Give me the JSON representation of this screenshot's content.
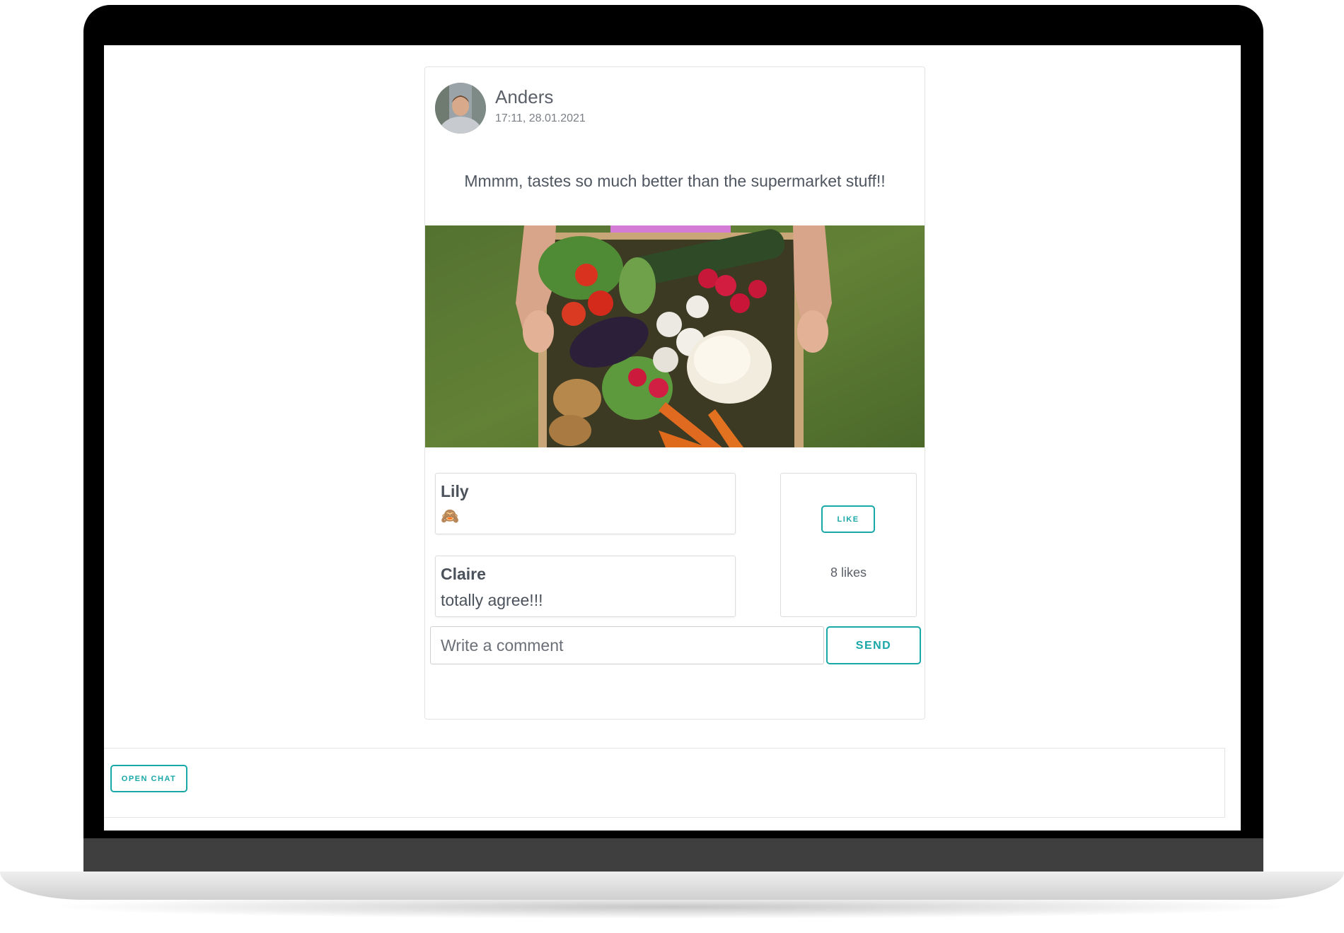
{
  "post": {
    "author": "Anders",
    "timestamp": "17:11, 28.01.2021",
    "text": "Mmmm, tastes so much better than the supermarket stuff!!",
    "image_alt": "crate of fresh vegetables held over grass"
  },
  "comments": [
    {
      "name": "Lily",
      "text": "🙈"
    },
    {
      "name": "Claire",
      "text": "totally agree!!!"
    }
  ],
  "likes": {
    "button_label": "LIKE",
    "count_text": "8 likes"
  },
  "composer": {
    "placeholder": "Write a comment",
    "send_label": "SEND"
  },
  "chat": {
    "open_label": "OPEN CHAT"
  },
  "colors": {
    "accent": "#1aa7a7",
    "text": "#4f5660",
    "border": "#dcdcdc"
  }
}
